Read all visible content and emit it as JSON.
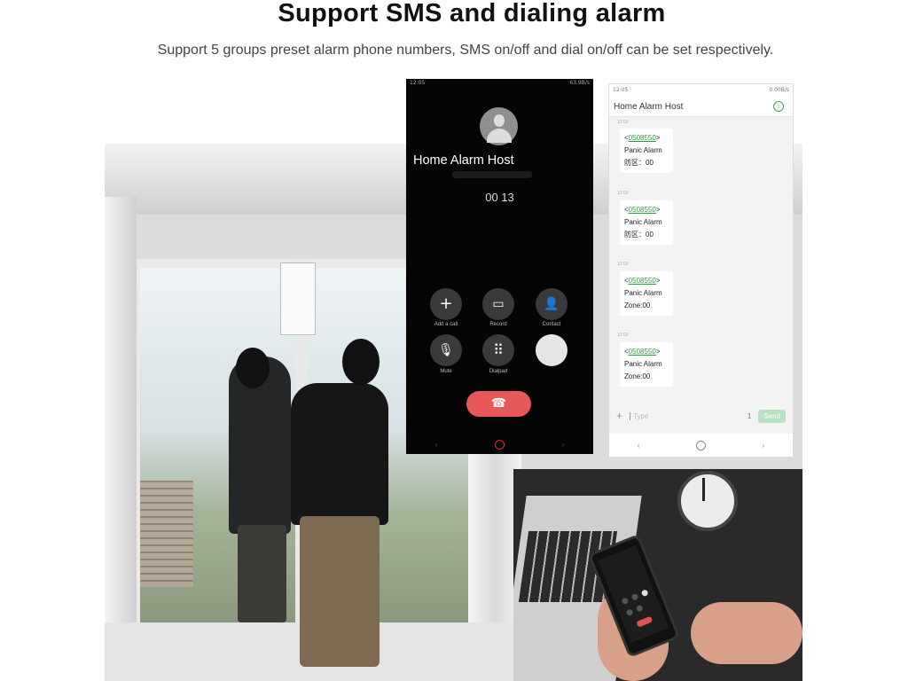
{
  "heading": {
    "title": "Support SMS and dialing alarm",
    "subtitle": "Support 5 groups preset alarm phone numbers, SMS on/off and dial on/off can be set respectively."
  },
  "call_screen": {
    "status_time": "12:05",
    "status_right": "63.9B/s",
    "caller_name": "Home Alarm Host",
    "timer": "00 13",
    "controls": [
      {
        "icon": "plus-icon",
        "glyph": "+",
        "label": "Add a call"
      },
      {
        "icon": "record-icon",
        "glyph": "▭",
        "label": "Record"
      },
      {
        "icon": "contact-icon",
        "glyph": "👤",
        "label": "Contact"
      },
      {
        "icon": "mute-icon",
        "glyph": "🎙",
        "label": "Mute"
      },
      {
        "icon": "dialpad-icon",
        "glyph": "⠿",
        "label": "Dialpad"
      },
      {
        "icon": "speaker-icon",
        "glyph": "",
        "label": ""
      }
    ],
    "hangup_glyph": "☎",
    "nav": {
      "left": "‹",
      "right": "›"
    }
  },
  "sms_screen": {
    "status_time": "12:05",
    "status_right": "0.00B/s",
    "title": "Home Alarm Host",
    "info_glyph": "i",
    "messages": [
      {
        "time": "12:03",
        "number": "0508550",
        "line1": "Panic Alarm",
        "line2": "防区：00"
      },
      {
        "time": "12:03",
        "number": "0508550",
        "line1": "Panic Alarm",
        "line2": "防区：00"
      },
      {
        "time": "12:03",
        "number": "0508550",
        "line1": "Panic Alarm",
        "line2": "Zone:00"
      },
      {
        "time": "12:03",
        "number": "0508550",
        "line1": "Panic Alarm",
        "line2": "Zone:00"
      }
    ],
    "input_placeholder": "Type",
    "plus_glyph": "+",
    "sim_label": "1",
    "send_label": "Send"
  }
}
